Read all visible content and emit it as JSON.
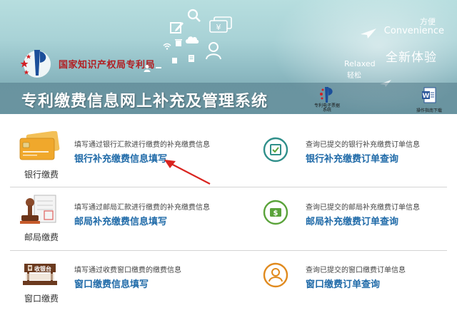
{
  "header": {
    "agency_name": "国家知识产权局专利局",
    "system_title": "专利缴费信息网上补充及管理系统",
    "convenience_cn": "方便",
    "convenience_en": "Convenience",
    "new_experience": "全新体验",
    "relaxed_en": "Relaxed",
    "relaxed_cn": "轻松",
    "ebill_label": "专利电子票据系统",
    "guide_label": "操作指南下载"
  },
  "rows": [
    {
      "method_label": "银行缴费",
      "fill_desc": "填写通过银行汇款进行缴费的补充缴费信息",
      "fill_link": "银行补充缴费信息填写",
      "query_desc": "查询已提交的银行补充缴费订单信息",
      "query_link": "银行补充缴费订单查询"
    },
    {
      "method_label": "邮局缴费",
      "fill_desc": "填写通过邮局汇款进行缴费的补充缴费信息",
      "fill_link": "邮局补充缴费信息填写",
      "query_desc": "查询已提交的邮局补充缴费订单信息",
      "query_link": "邮局补充缴费订单查询"
    },
    {
      "method_label": "窗口缴费",
      "cashier_sign": "收银台",
      "fill_desc": "填写通过收费窗口缴费的缴费信息",
      "fill_link": "窗口缴费信息填写",
      "query_desc": "查询已提交的窗口缴费订单信息",
      "query_link": "窗口缴费订单查询"
    }
  ],
  "colors": {
    "link": "#1f6aa8",
    "accent_green": "#5aa33a",
    "accent_teal": "#2f8f8a",
    "accent_orange": "#e08a1e",
    "annotation_red": "#d9241f"
  },
  "icons": {
    "bank": "bank-card-icon",
    "post": "post-office-stamp-icon",
    "window": "cashier-counter-icon",
    "bank_query": "cart-check-icon",
    "post_query": "dollar-bill-icon",
    "window_query": "person-icon"
  }
}
